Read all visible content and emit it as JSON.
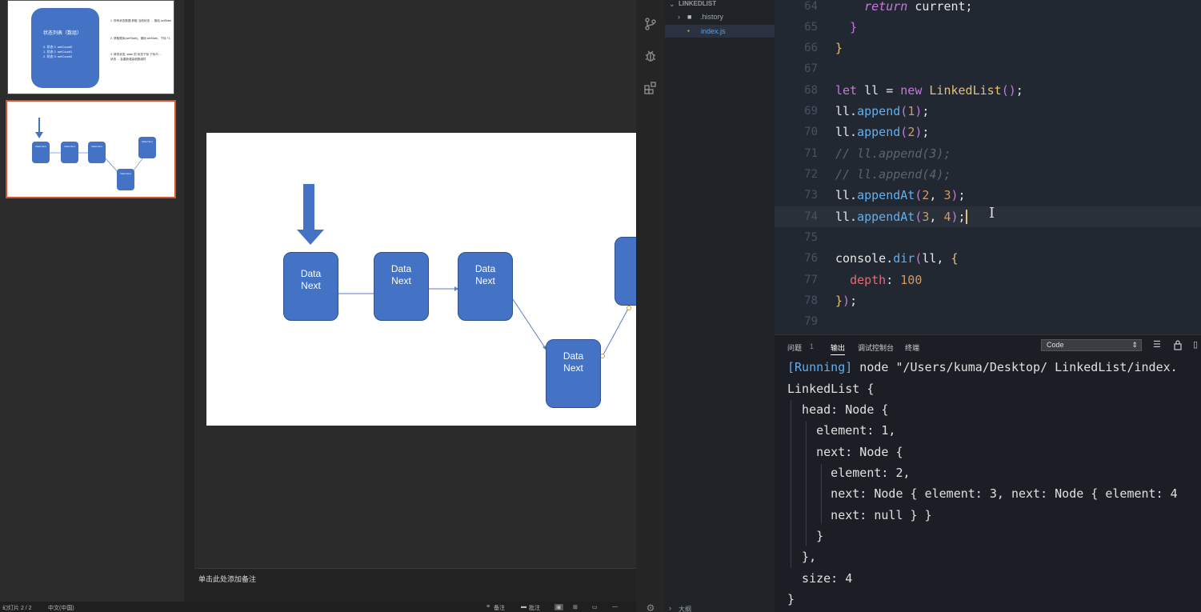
{
  "ppt": {
    "thumb1": {
      "box_title": "状态列表（数组）",
      "box_lines": [
        "0. 状态    2. setCount0",
        "1. 状态    2. setCount1",
        "2. 状态    3. setCount2"
      ],
      "side_lines": [
        "1. 所有状态数据    获取 当前状态 → 推给 setState",
        "2. 获取顺序(setState)，调用 setState，下标 +1",
        "3. 修改状态, state 的 状态下标  下标与 ...",
        "状态 ... 会重新渲染函数组件"
      ]
    },
    "thumb2": {
      "node_label": "Data Next"
    },
    "slide": {
      "node_line1": "Data",
      "node_line2": "Next"
    },
    "notes_placeholder": "单击此处添加备注",
    "status": {
      "slide_info": "幻灯片 2 / 2",
      "language": "中文(中国)",
      "notes_btn": "备注",
      "comments_btn": "批注"
    }
  },
  "vscode": {
    "explorer": {
      "title": "LINKEDLIST",
      "items": [
        ".history",
        "index.js"
      ],
      "outline": "大纲"
    },
    "editor": {
      "line_numbers": [
        "64",
        "65",
        "66",
        "67",
        "68",
        "69",
        "70",
        "71",
        "72",
        "73",
        "74",
        "75",
        "76",
        "77",
        "78",
        "79"
      ]
    },
    "panel": {
      "tabs": [
        "问题",
        "输出",
        "调试控制台",
        "终端"
      ],
      "problems_badge": "1",
      "select_value": "Code",
      "running_tag": "[Running]",
      "running_cmd": " node \"/Users/kuma/Desktop/ LinkedList/index.",
      "output_lines": [
        "LinkedList {",
        "  head: Node {",
        "    element: 1,",
        "    next: Node {",
        "      element: 2,",
        "      next: Node { element: 3, next: Node { element: 4",
        "      next: null } }",
        "    }",
        "  },",
        "  size: 4",
        "}"
      ]
    }
  },
  "colors": {
    "accent_orange": "#d35230",
    "node_blue": "#4472c4",
    "editor_bg": "#222831"
  }
}
